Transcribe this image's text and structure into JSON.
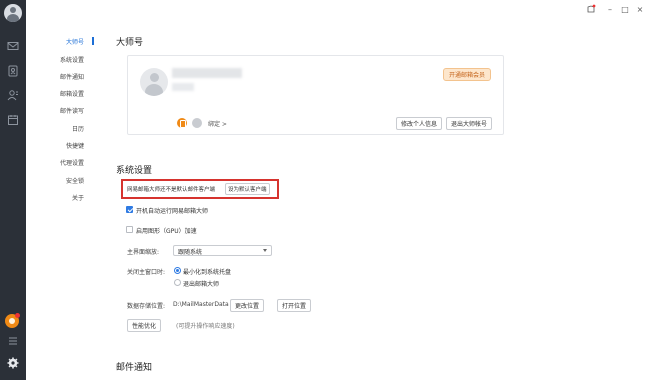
{
  "colors": {
    "accent": "#1d6fd6",
    "rail": "#2b3038",
    "highlight": "#d6332e",
    "vip": "#c4631a"
  },
  "rail_icons": [
    "mail-icon",
    "contacts-book-icon",
    "contacts-icon",
    "calendar-icon",
    "foxmail-icon",
    "menu-icon",
    "gear-icon"
  ],
  "nav": {
    "items": [
      {
        "label": "大师号",
        "active": true
      },
      {
        "label": "系统设置"
      },
      {
        "label": "邮件通知"
      },
      {
        "label": "邮箱设置"
      },
      {
        "label": "邮件读写"
      },
      {
        "label": "日历"
      },
      {
        "label": "快捷键"
      },
      {
        "label": "代理设置"
      },
      {
        "label": "安全锁"
      },
      {
        "label": "关于"
      }
    ]
  },
  "window": {
    "skin_icon": "skin-icon",
    "min": "–",
    "max": "□",
    "close": "×"
  },
  "master": {
    "title": "大师号",
    "vip_label": "开通邮箱会员",
    "bind_label": "绑定 >",
    "edit_profile": "修改个人信息",
    "logout": "退出大师帐号"
  },
  "system": {
    "title": "系统设置",
    "default_client_text": "网易邮箱大师还不是默认邮件客户端",
    "default_client_button": "设为默认客户端",
    "autostart_label": "开机自动运行网易邮箱大师",
    "autostart_checked": true,
    "gpu_label": "启用图形（GPU）加速",
    "gpu_checked": false,
    "scale_label": "主界面缩放:",
    "scale_value": "跟随系统",
    "close_label": "关闭主窗口时:",
    "close_options": [
      "最小化到系统托盘",
      "退出邮箱大师"
    ],
    "close_selected": 0,
    "storage_label": "数据存储位置:",
    "storage_path": "D:\\MailMasterData",
    "change_location": "更改位置",
    "open_location": "打开位置",
    "optimize_button": "性能优化",
    "optimize_note": "(可提升操作响应速度)"
  },
  "notify": {
    "title": "邮件通知"
  }
}
